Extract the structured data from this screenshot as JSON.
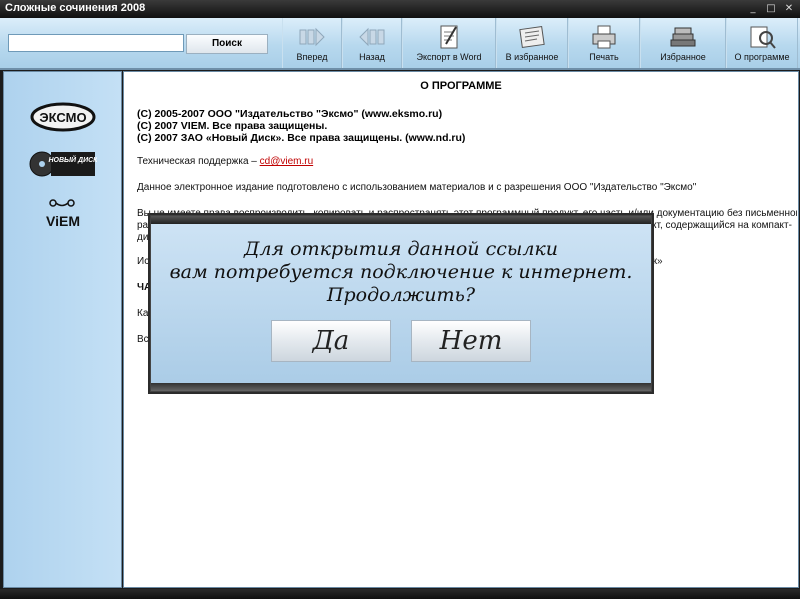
{
  "window": {
    "title": "Сложные сочинения 2008",
    "minimize": "_",
    "maximize": "□",
    "close": "✕"
  },
  "toolbar": {
    "search_placeholder": "",
    "search_button": "Поиск",
    "buttons": [
      {
        "label": "Вперед",
        "icon": "forward-icon"
      },
      {
        "label": "Назад",
        "icon": "back-icon"
      },
      {
        "label": "Экспорт в Word",
        "icon": "export-word-icon"
      },
      {
        "label": "В избранное",
        "icon": "add-favorite-icon"
      },
      {
        "label": "Печать",
        "icon": "printer-icon"
      },
      {
        "label": "Избранное",
        "icon": "books-icon"
      },
      {
        "label": "О программе",
        "icon": "about-icon"
      }
    ]
  },
  "sidebar": {
    "logos": [
      "ЭКСМО",
      "НОВЫЙ ДИСК",
      "ViEM"
    ]
  },
  "main": {
    "title": "О ПРОГРАММЕ",
    "copyright": [
      "(C) 2005-2007 ООО \"Издательство \"Эксмо\" (www.eksmo.ru)",
      "(C) 2007 VIEM. Все права защищены.",
      "(C) 2007 ЗАО «Новый Диск». Все права защищены. (www.nd.ru)"
    ],
    "support_text": "Техническая поддержка – ",
    "support_email": "cd@viem.ru",
    "published_text": "Данное электронное издание подготовлено с использованием материалов и с разрешения ООО \"Издательство \"Эксмо\"",
    "rights_line1": "Вы не имеете права воспроизводить, копировать и распространять этот программный продукт, его часть и/или документацию без письменного",
    "rights_line2": "раз",
    "rights_line2_end": "кт, содержащийся на компакт-",
    "rights_line3": "дис",
    "excl_start": "Иск",
    "excl_end": "иск»",
    "part_label": "ЧА",
    "how_label": "Как",
    "all_label": "Все"
  },
  "dialog": {
    "line1": "Для открытия данной ссылки",
    "line2": "вам потребуется подключение к интернет.",
    "line3": "Продолжить?",
    "yes": "Да",
    "no": "Нет"
  }
}
